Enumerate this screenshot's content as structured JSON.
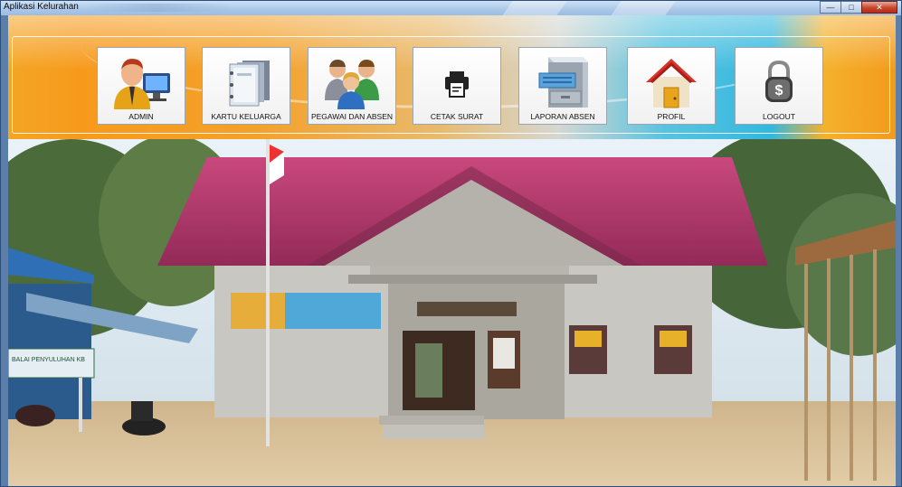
{
  "window": {
    "title": "Aplikasi Kelurahan",
    "minimize_glyph": "—",
    "maximize_glyph": "□",
    "close_glyph": "✕"
  },
  "menu": [
    {
      "label": "ADMIN",
      "icon": "admin-user-icon"
    },
    {
      "label": "KARTU KELUARGA",
      "icon": "binder-icon"
    },
    {
      "label": "PEGAWAI DAN ABSEN",
      "icon": "people-group-icon"
    },
    {
      "label": "CETAK SURAT",
      "icon": "printer-icon"
    },
    {
      "label": "LAPORAN ABSEN",
      "icon": "file-cabinet-icon"
    },
    {
      "label": "PROFIL",
      "icon": "home-icon"
    },
    {
      "label": "LOGOUT",
      "icon": "padlock-dollar-icon"
    }
  ],
  "colors": {
    "banner_orange": "#f59e1e",
    "banner_cyan": "#33b8df",
    "roof": "#b0366a",
    "wall": "#c9c7c2",
    "sand": "#d9c4a0"
  }
}
